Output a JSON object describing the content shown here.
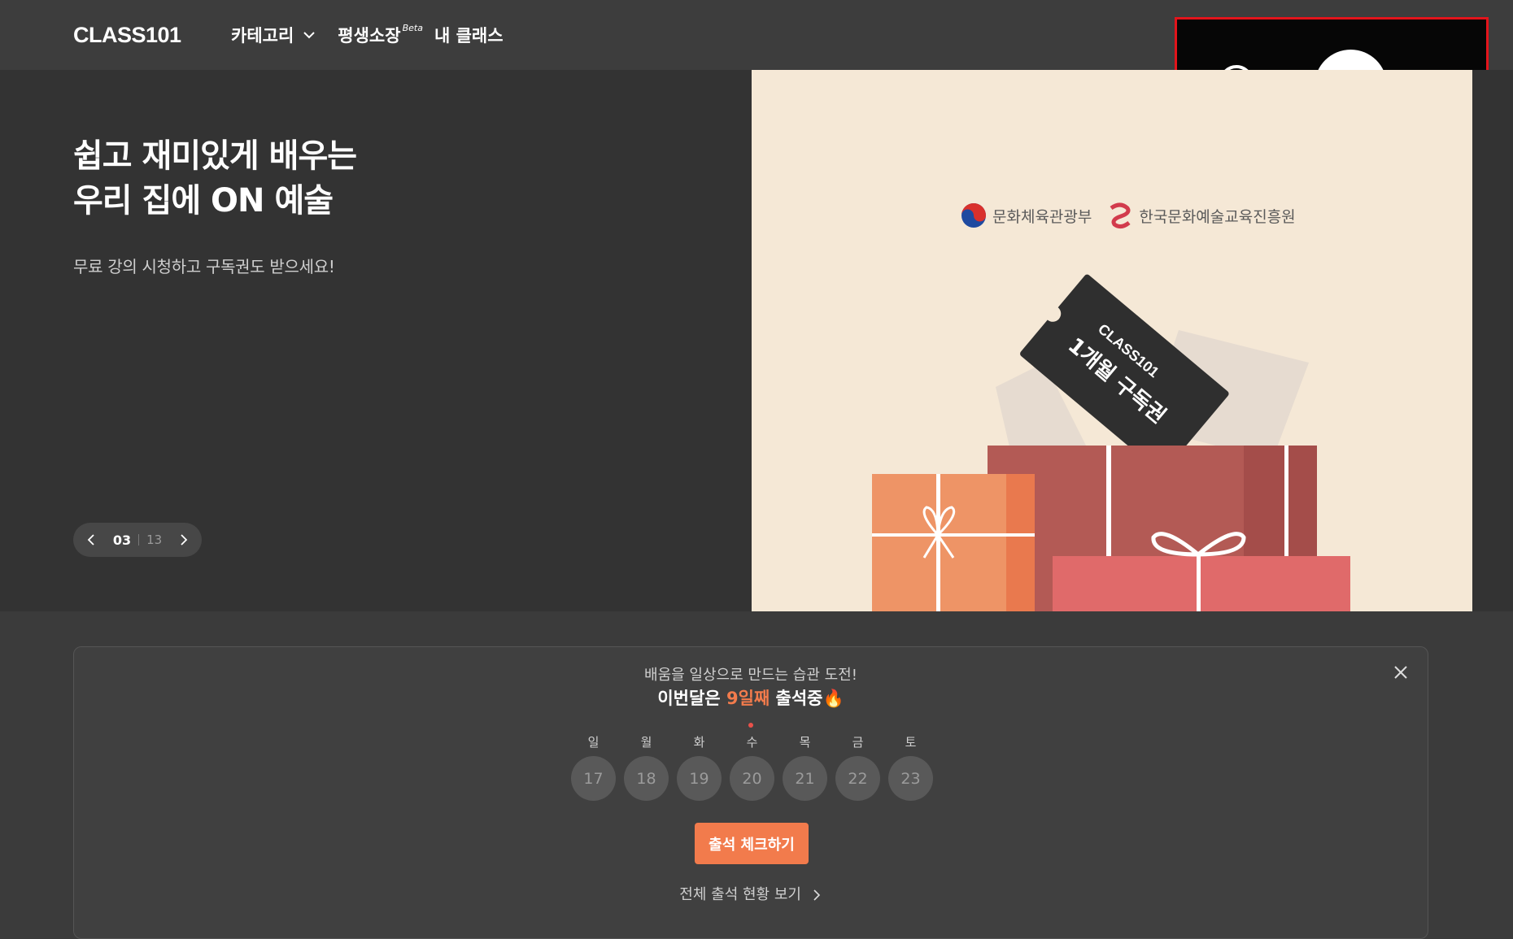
{
  "header": {
    "logo": "CLASS101",
    "nav": {
      "category": "카테고리",
      "lifetime": "평생소장",
      "lifetime_badge": "Beta",
      "my_classes": "내 클래스"
    }
  },
  "hero": {
    "title": "쉽고 재미있게 배우는\n우리 집에 ON 예술",
    "subtitle": "무료 강의 시청하고 구독권도 받으세요!",
    "pager": {
      "current": "03",
      "total": "13"
    },
    "sponsors": [
      "문화체육관광부",
      "한국문화예술교육진흥원"
    ],
    "ticket": {
      "brand": "CLASS101",
      "text": "1개월 구독권"
    }
  },
  "attendance": {
    "intro": "배움을 일상으로 만드는 습관 도전!",
    "main_prefix": "이번달은 ",
    "main_highlight": "9일째",
    "main_suffix": " 출석중🔥",
    "days": [
      {
        "label": "일",
        "date": "17"
      },
      {
        "label": "월",
        "date": "18"
      },
      {
        "label": "화",
        "date": "19"
      },
      {
        "label": "수",
        "date": "20"
      },
      {
        "label": "목",
        "date": "21"
      },
      {
        "label": "금",
        "date": "22"
      },
      {
        "label": "토",
        "date": "23"
      }
    ],
    "button": "출석 체크하기",
    "link": "전체 출석 현황 보기"
  },
  "colors": {
    "accent": "#f27b4c",
    "highlight_border": "#e3141b",
    "today_dot": "#e9514a"
  }
}
